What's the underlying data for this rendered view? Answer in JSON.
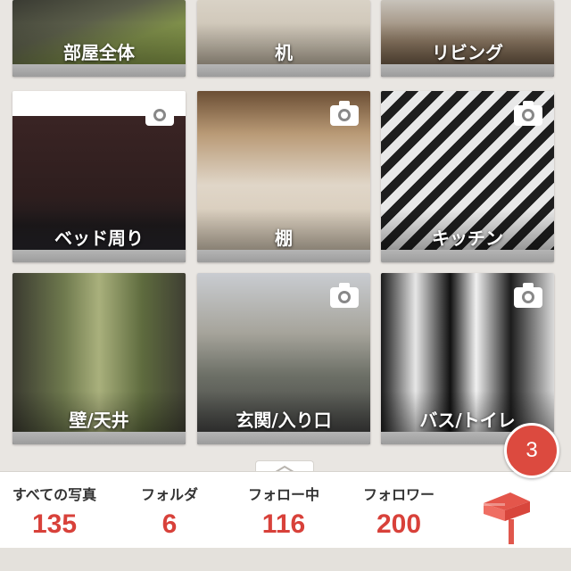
{
  "folders": [
    {
      "label": "部屋全体",
      "camera": false
    },
    {
      "label": "机",
      "camera": false
    },
    {
      "label": "リビング",
      "camera": false
    },
    {
      "label": "ベッド周り",
      "camera": true
    },
    {
      "label": "棚",
      "camera": true
    },
    {
      "label": "キッチン",
      "camera": true
    },
    {
      "label": "壁/天井",
      "camera": false
    },
    {
      "label": "玄関/入り口",
      "camera": true
    },
    {
      "label": "バス/トイレ",
      "camera": true
    }
  ],
  "stats": {
    "all_photos_label": "すべての写真",
    "all_photos_count": "135",
    "folders_label": "フォルダ",
    "folders_count": "6",
    "following_label": "フォロー中",
    "following_count": "116",
    "followers_label": "フォロワー",
    "followers_count": "200"
  },
  "notification_badge": "3",
  "colors": {
    "accent": "#d8413a",
    "badge": "#dc4a3f",
    "background": "#e9e6e2"
  },
  "icons": {
    "camera": "camera-icon",
    "mailbox": "mailbox-icon",
    "chevron": "chevron-up-icon"
  }
}
